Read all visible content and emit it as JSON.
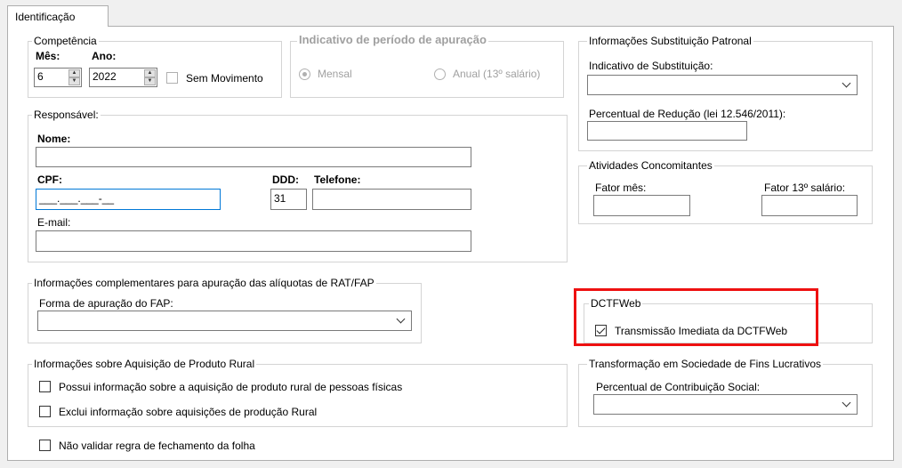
{
  "tab": {
    "label": "Identificação"
  },
  "competencia": {
    "title": "Competência",
    "mes_label": "Mês:",
    "ano_label": "Ano:",
    "mes_value": "6",
    "ano_value": "2022",
    "sem_movimento": "Sem Movimento"
  },
  "periodo": {
    "title": "Indicativo de período de apuração",
    "mensal": "Mensal",
    "anual": "Anual (13º salário)"
  },
  "substituicao": {
    "title": "Informações Substituição Patronal",
    "indicativo_label": "Indicativo de Substituição:",
    "indicativo_value": "",
    "percentual_label": "Percentual de Redução  (lei 12.546/2011):",
    "percentual_value": ""
  },
  "responsavel": {
    "title": "Responsável:",
    "nome_label": "Nome:",
    "nome_value": "",
    "cpf_label": "CPF:",
    "cpf_value": "___.___.___-__",
    "ddd_label": "DDD:",
    "ddd_value": "31",
    "telefone_label": "Telefone:",
    "telefone_value": "",
    "email_label": "E-mail:",
    "email_value": ""
  },
  "atividades": {
    "title": "Atividades Concomitantes",
    "fator_mes_label": "Fator mês:",
    "fator_13_label": "Fator 13º salário:"
  },
  "rat": {
    "title": "Informações complementares para apuração das alíquotas de RAT/FAP",
    "forma_label": "Forma de apuração do FAP:",
    "forma_value": ""
  },
  "dctfweb": {
    "title": "DCTFWeb",
    "transmissao": "Transmissão Imediata da DCTFWeb",
    "checked": true
  },
  "rural": {
    "title": "Informações sobre Aquisição de Produto Rural",
    "opt1": "Possui informação sobre a aquisição de produto rural de pessoas físicas",
    "opt2": "Exclui informação sobre aquisições de produção Rural"
  },
  "transformacao": {
    "title": "Transformação em Sociedade de Fins Lucrativos",
    "percentual_label": "Percentual de Contribuição Social:",
    "percentual_value": ""
  },
  "nao_validar": "Não validar regra de fechamento da folha",
  "colors": {
    "highlight": "#ee1111",
    "focus": "#0078d7"
  }
}
